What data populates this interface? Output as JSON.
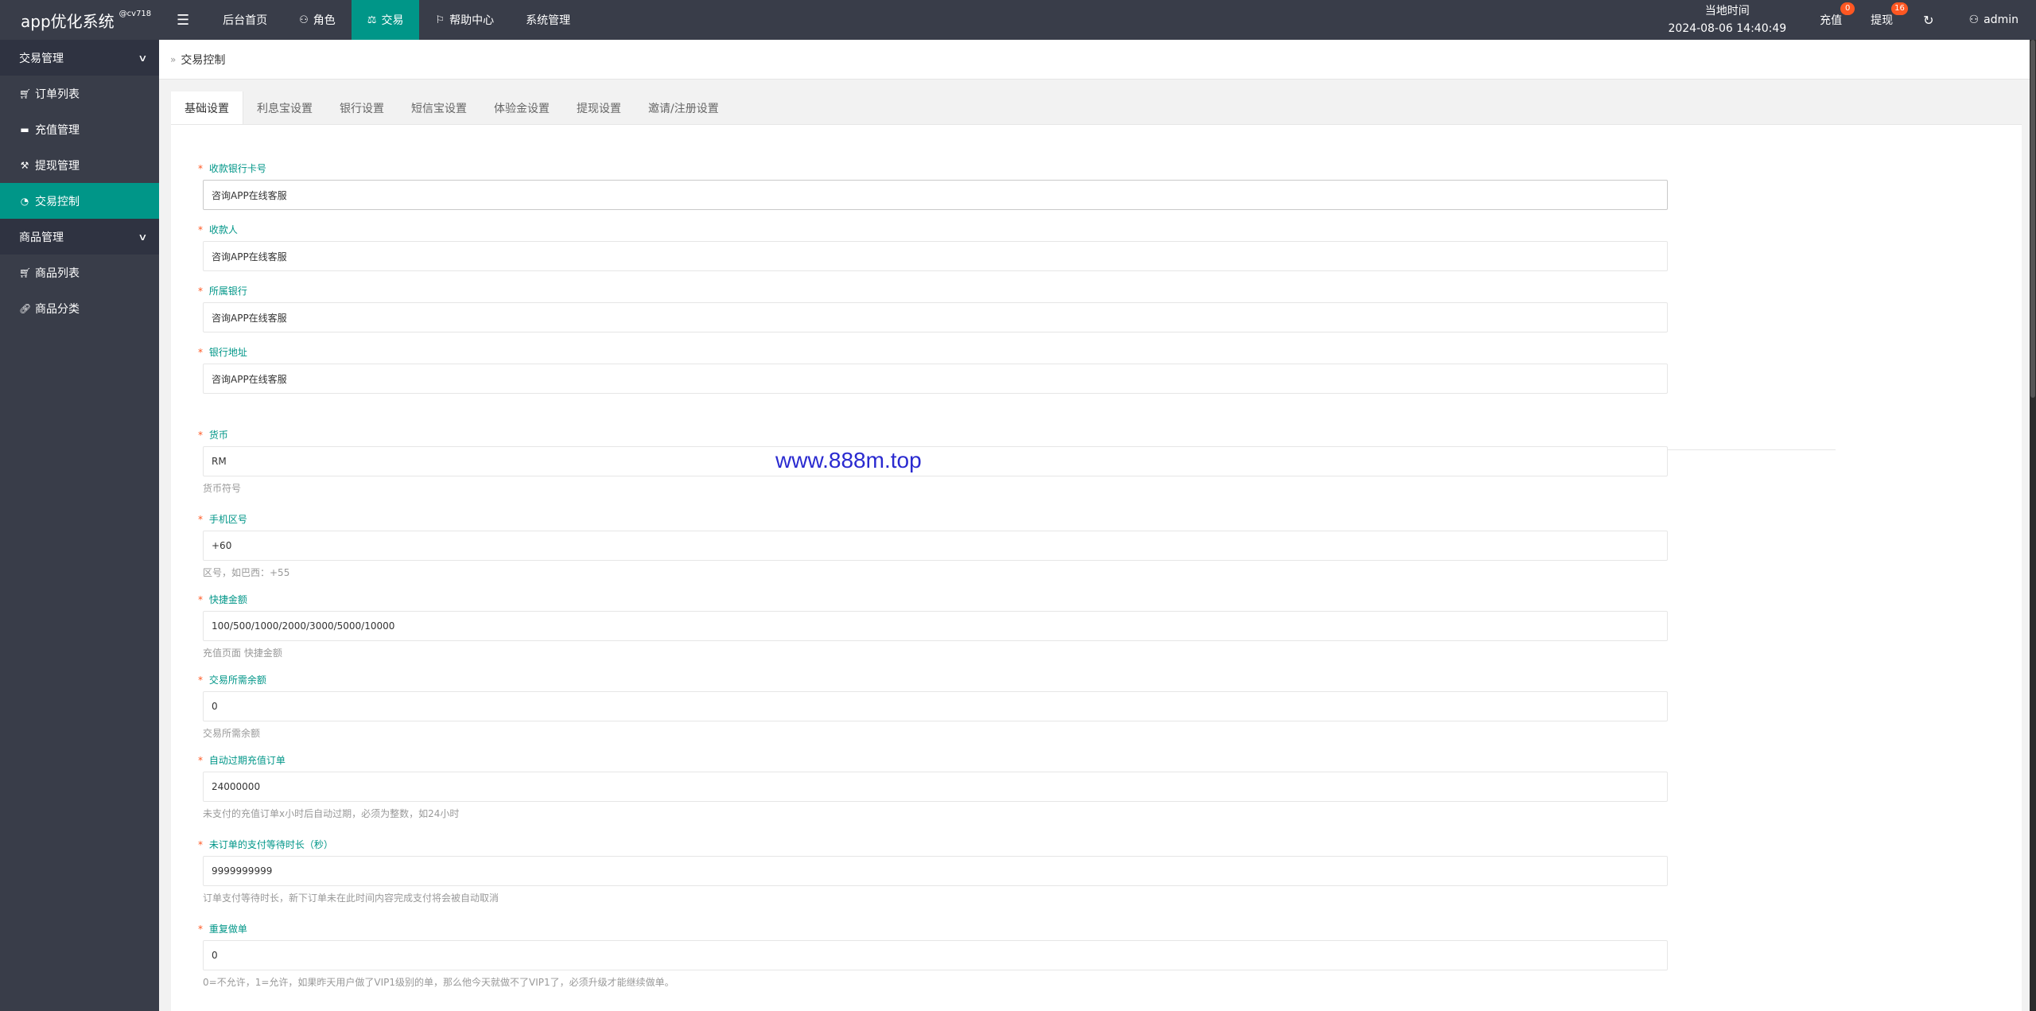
{
  "app": {
    "title": "app优化系统",
    "version": "@cv718"
  },
  "topnav": {
    "menu_icon": "hamburger-icon",
    "items": [
      {
        "label": "后台首页",
        "icon": ""
      },
      {
        "label": "角色",
        "icon": "user-icon"
      },
      {
        "label": "交易",
        "icon": "balance-icon"
      },
      {
        "label": "帮助中心",
        "icon": "flag-icon"
      },
      {
        "label": "系统管理",
        "icon": ""
      }
    ],
    "active": "交易"
  },
  "header_right": {
    "time_label": "当地时间",
    "time_value": "2024-08-06 14:40:49",
    "recharge": {
      "label": "充值",
      "badge": "0"
    },
    "withdraw": {
      "label": "提现",
      "badge": "16"
    },
    "refresh_icon": "refresh-icon",
    "user": {
      "label": "admin",
      "icon": "user-icon"
    }
  },
  "sidebar": {
    "groups": [
      {
        "label": "交易管理",
        "items": [
          {
            "label": "订单列表",
            "icon": "cart-icon"
          },
          {
            "label": "充值管理",
            "icon": "comment-icon"
          },
          {
            "label": "提现管理",
            "icon": "hammer-icon"
          },
          {
            "label": "交易控制",
            "icon": "dashboard-icon"
          }
        ]
      },
      {
        "label": "商品管理",
        "items": [
          {
            "label": "商品列表",
            "icon": "cart-icon"
          },
          {
            "label": "商品分类",
            "icon": "link-icon"
          }
        ]
      }
    ],
    "active": "交易控制"
  },
  "breadcrumb": {
    "label": "交易控制"
  },
  "tabs": [
    "基础设置",
    "利息宝设置",
    "银行设置",
    "短信宝设置",
    "体验金设置",
    "提现设置",
    "邀请/注册设置"
  ],
  "form": {
    "fields": [
      {
        "label": "收款银行卡号",
        "value": "咨询APP在线客服",
        "help": ""
      },
      {
        "label": "收款人",
        "value": "咨询APP在线客服",
        "help": ""
      },
      {
        "label": "所属银行",
        "value": "咨询APP在线客服",
        "help": ""
      },
      {
        "label": "银行地址",
        "value": "咨询APP在线客服",
        "help": ""
      },
      {
        "label": "货币",
        "value": "RM",
        "help": "货币符号"
      },
      {
        "label": "手机区号",
        "value": "+60",
        "help": "区号，如巴西：+55"
      },
      {
        "label": "快捷金额",
        "value": "100/500/1000/2000/3000/5000/10000",
        "help": "充值页面 快捷金额"
      },
      {
        "label": "交易所需余额",
        "value": "0",
        "help": "交易所需余额"
      },
      {
        "label": "自动过期充值订单",
        "value": "24000000",
        "help": "未支付的充值订单x小时后自动过期，必须为整数，如24小时"
      },
      {
        "label": "未订单的支付等待时长（秒）",
        "value": "9999999999",
        "help": "订单支付等待时长，新下订单未在此时间内容完成支付将会被自动取消"
      },
      {
        "label": "重复做单",
        "value": "0",
        "help": "0=不允许，1=允许，如果昨天用户做了VIP1级别的单，那么他今天就做不了VIP1了，必须升级才能继续做单。"
      }
    ]
  },
  "watermark": "www.888m.top"
}
